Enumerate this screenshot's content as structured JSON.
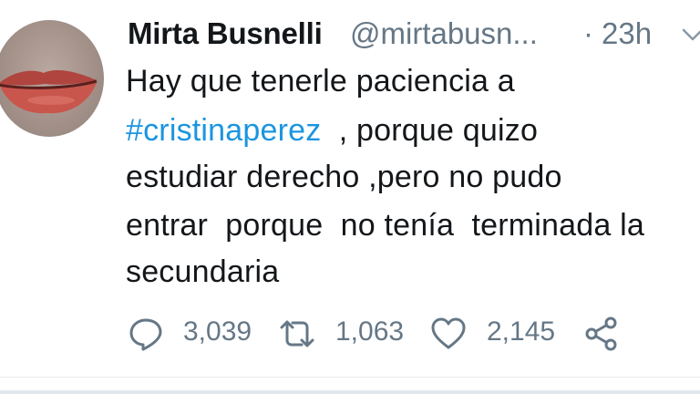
{
  "tweet": {
    "author_name": "Mirta Busnelli",
    "author_handle": "@mirtabusn...",
    "separator": "·",
    "time": "23h",
    "text": {
      "line1": "Hay que tenerle paciencia a",
      "hashtag": "#cristinaperez",
      "line2_rest": "  , porque quizo",
      "line3": "estudiar derecho ,pero no pudo",
      "line4": "entrar  porque  no tenía  terminada la",
      "line5": "secundaria"
    },
    "stats": {
      "replies": "3,039",
      "retweets": "1,063",
      "likes": "2,145"
    },
    "icons": {
      "reply": "reply-icon",
      "retweet": "retweet-icon",
      "like": "heart-icon",
      "share": "share-icon",
      "menu": "chevron-down-icon"
    },
    "colors": {
      "text": "#14171a",
      "secondary": "#657786",
      "link": "#1b95e0"
    }
  }
}
